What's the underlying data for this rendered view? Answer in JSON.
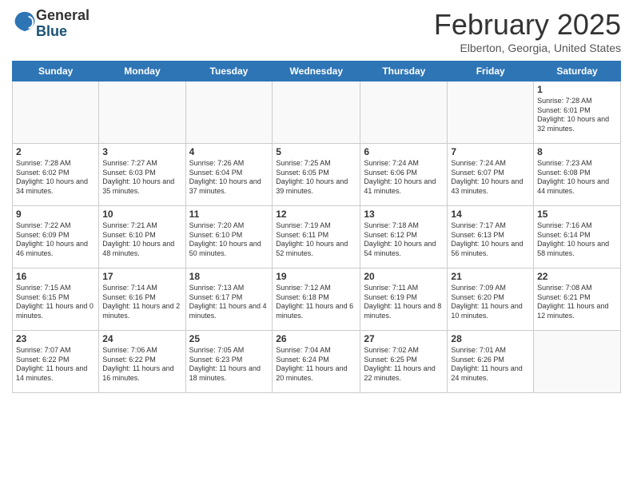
{
  "header": {
    "logo_general": "General",
    "logo_blue": "Blue",
    "title": "February 2025",
    "location": "Elberton, Georgia, United States"
  },
  "days_of_week": [
    "Sunday",
    "Monday",
    "Tuesday",
    "Wednesday",
    "Thursday",
    "Friday",
    "Saturday"
  ],
  "weeks": [
    [
      {
        "day": "",
        "info": ""
      },
      {
        "day": "",
        "info": ""
      },
      {
        "day": "",
        "info": ""
      },
      {
        "day": "",
        "info": ""
      },
      {
        "day": "",
        "info": ""
      },
      {
        "day": "",
        "info": ""
      },
      {
        "day": "1",
        "info": "Sunrise: 7:28 AM\nSunset: 6:01 PM\nDaylight: 10 hours and 32 minutes."
      }
    ],
    [
      {
        "day": "2",
        "info": "Sunrise: 7:28 AM\nSunset: 6:02 PM\nDaylight: 10 hours and 34 minutes."
      },
      {
        "day": "3",
        "info": "Sunrise: 7:27 AM\nSunset: 6:03 PM\nDaylight: 10 hours and 35 minutes."
      },
      {
        "day": "4",
        "info": "Sunrise: 7:26 AM\nSunset: 6:04 PM\nDaylight: 10 hours and 37 minutes."
      },
      {
        "day": "5",
        "info": "Sunrise: 7:25 AM\nSunset: 6:05 PM\nDaylight: 10 hours and 39 minutes."
      },
      {
        "day": "6",
        "info": "Sunrise: 7:24 AM\nSunset: 6:06 PM\nDaylight: 10 hours and 41 minutes."
      },
      {
        "day": "7",
        "info": "Sunrise: 7:24 AM\nSunset: 6:07 PM\nDaylight: 10 hours and 43 minutes."
      },
      {
        "day": "8",
        "info": "Sunrise: 7:23 AM\nSunset: 6:08 PM\nDaylight: 10 hours and 44 minutes."
      }
    ],
    [
      {
        "day": "9",
        "info": "Sunrise: 7:22 AM\nSunset: 6:09 PM\nDaylight: 10 hours and 46 minutes."
      },
      {
        "day": "10",
        "info": "Sunrise: 7:21 AM\nSunset: 6:10 PM\nDaylight: 10 hours and 48 minutes."
      },
      {
        "day": "11",
        "info": "Sunrise: 7:20 AM\nSunset: 6:10 PM\nDaylight: 10 hours and 50 minutes."
      },
      {
        "day": "12",
        "info": "Sunrise: 7:19 AM\nSunset: 6:11 PM\nDaylight: 10 hours and 52 minutes."
      },
      {
        "day": "13",
        "info": "Sunrise: 7:18 AM\nSunset: 6:12 PM\nDaylight: 10 hours and 54 minutes."
      },
      {
        "day": "14",
        "info": "Sunrise: 7:17 AM\nSunset: 6:13 PM\nDaylight: 10 hours and 56 minutes."
      },
      {
        "day": "15",
        "info": "Sunrise: 7:16 AM\nSunset: 6:14 PM\nDaylight: 10 hours and 58 minutes."
      }
    ],
    [
      {
        "day": "16",
        "info": "Sunrise: 7:15 AM\nSunset: 6:15 PM\nDaylight: 11 hours and 0 minutes."
      },
      {
        "day": "17",
        "info": "Sunrise: 7:14 AM\nSunset: 6:16 PM\nDaylight: 11 hours and 2 minutes."
      },
      {
        "day": "18",
        "info": "Sunrise: 7:13 AM\nSunset: 6:17 PM\nDaylight: 11 hours and 4 minutes."
      },
      {
        "day": "19",
        "info": "Sunrise: 7:12 AM\nSunset: 6:18 PM\nDaylight: 11 hours and 6 minutes."
      },
      {
        "day": "20",
        "info": "Sunrise: 7:11 AM\nSunset: 6:19 PM\nDaylight: 11 hours and 8 minutes."
      },
      {
        "day": "21",
        "info": "Sunrise: 7:09 AM\nSunset: 6:20 PM\nDaylight: 11 hours and 10 minutes."
      },
      {
        "day": "22",
        "info": "Sunrise: 7:08 AM\nSunset: 6:21 PM\nDaylight: 11 hours and 12 minutes."
      }
    ],
    [
      {
        "day": "23",
        "info": "Sunrise: 7:07 AM\nSunset: 6:22 PM\nDaylight: 11 hours and 14 minutes."
      },
      {
        "day": "24",
        "info": "Sunrise: 7:06 AM\nSunset: 6:22 PM\nDaylight: 11 hours and 16 minutes."
      },
      {
        "day": "25",
        "info": "Sunrise: 7:05 AM\nSunset: 6:23 PM\nDaylight: 11 hours and 18 minutes."
      },
      {
        "day": "26",
        "info": "Sunrise: 7:04 AM\nSunset: 6:24 PM\nDaylight: 11 hours and 20 minutes."
      },
      {
        "day": "27",
        "info": "Sunrise: 7:02 AM\nSunset: 6:25 PM\nDaylight: 11 hours and 22 minutes."
      },
      {
        "day": "28",
        "info": "Sunrise: 7:01 AM\nSunset: 6:26 PM\nDaylight: 11 hours and 24 minutes."
      },
      {
        "day": "",
        "info": ""
      }
    ]
  ]
}
